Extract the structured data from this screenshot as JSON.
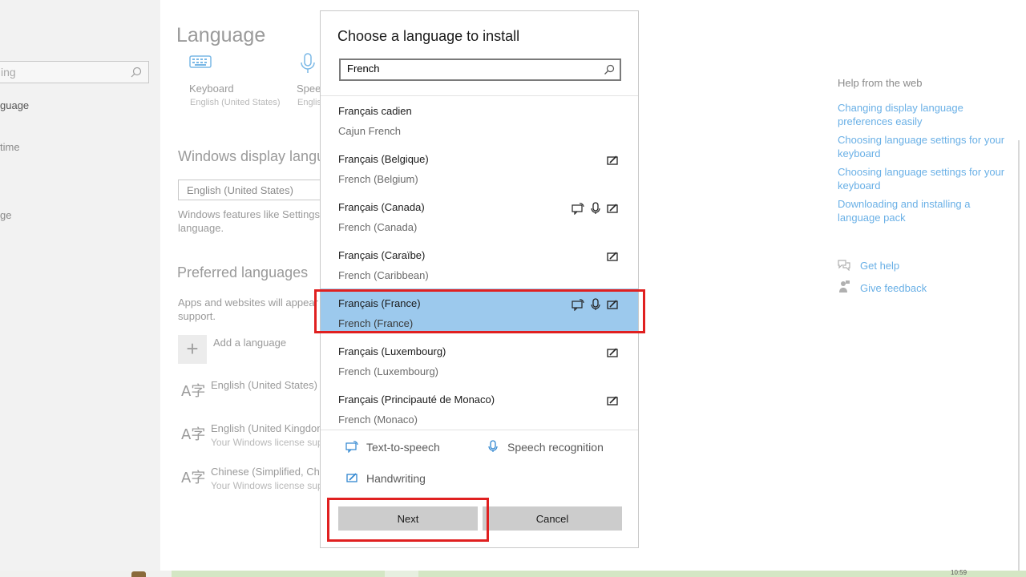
{
  "left_nav": {
    "search_placeholder": "ing",
    "items": [
      "guage",
      "time",
      "ge"
    ]
  },
  "settings": {
    "page_title": "Language",
    "keyboard": {
      "label": "Keyboard",
      "sub": "English (United States)"
    },
    "speech": {
      "label": "Speec",
      "sub": "Englis"
    },
    "display_language": {
      "heading": "Windows display langu",
      "selected": "English (United States)",
      "description_line1": "Windows features like Settings a",
      "description_line2": "language."
    },
    "preferred": {
      "heading": "Preferred languages",
      "description_line1": "Apps and websites will appear in",
      "description_line2": "support.",
      "add_label": "Add a language",
      "languages": [
        {
          "name": "English (United States)",
          "sub": ""
        },
        {
          "name": "English (United Kingdom",
          "sub": "Your Windows license sup"
        },
        {
          "name": "Chinese (Simplified, Chin",
          "sub": "Your Windows license sup"
        }
      ]
    }
  },
  "right_panel": {
    "heading": "Help from the web",
    "links": [
      [
        "Changing display language",
        "preferences easily"
      ],
      [
        "Choosing language settings for your",
        "keyboard"
      ],
      [
        "Choosing language settings for your",
        "keyboard"
      ],
      [
        "Downloading and installing a",
        "language pack"
      ]
    ],
    "get_help": "Get help",
    "give_feedback": "Give feedback"
  },
  "dialog": {
    "title": "Choose a language to install",
    "search_value": "French",
    "languages": [
      {
        "native": "Français cadien",
        "english": "Cajun French",
        "features": []
      },
      {
        "native": "Français (Belgique)",
        "english": "French (Belgium)",
        "features": [
          "handwriting-icon"
        ]
      },
      {
        "native": "Français (Canada)",
        "english": "French (Canada)",
        "features": [
          "text-to-speech-icon",
          "microphone-icon",
          "handwriting-icon"
        ]
      },
      {
        "native": "Français (Caraïbe)",
        "english": "French (Caribbean)",
        "features": [
          "handwriting-icon"
        ]
      },
      {
        "native": "Français (France)",
        "english": "French (France)",
        "features": [
          "text-to-speech-icon",
          "microphone-icon",
          "handwriting-icon"
        ],
        "selected": true
      },
      {
        "native": "Français (Luxembourg)",
        "english": "French (Luxembourg)",
        "features": [
          "handwriting-icon"
        ]
      },
      {
        "native": "Français (Principauté de Monaco)",
        "english": "French (Monaco)",
        "features": [
          "handwriting-icon"
        ]
      }
    ],
    "legend": {
      "tts": "Text-to-speech",
      "speech": "Speech recognition",
      "handwriting": "Handwriting"
    },
    "next_label": "Next",
    "cancel_label": "Cancel"
  },
  "taskbar": {
    "clock": "10:59"
  },
  "colors": {
    "selection": "#9cc9ed",
    "link": "#6ab0e6",
    "highlight_annotation": "#e02020",
    "button": "#cccccc"
  }
}
